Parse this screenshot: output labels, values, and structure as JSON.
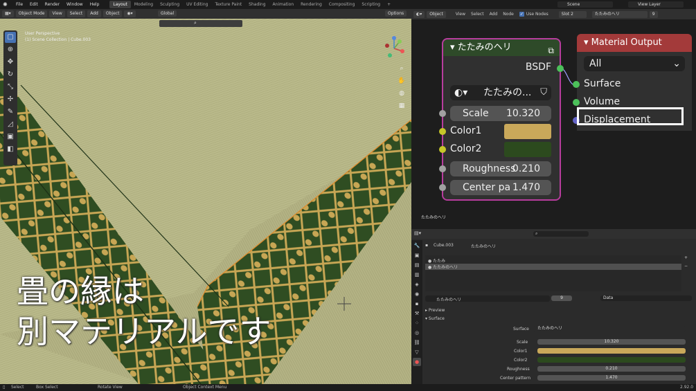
{
  "topbar": {
    "menus": [
      "File",
      "Edit",
      "Render",
      "Window",
      "Help"
    ],
    "workspaces": [
      "Layout",
      "Modeling",
      "Sculpting",
      "UV Editing",
      "Texture Paint",
      "Shading",
      "Animation",
      "Rendering",
      "Compositing",
      "Scripting"
    ],
    "active_workspace": "Layout",
    "scene": "Scene",
    "view_layer": "View Layer"
  },
  "viewport": {
    "mode": "Object Mode",
    "menus": [
      "View",
      "Select",
      "Add",
      "Object"
    ],
    "transform_orientation": "Global",
    "options_label": "Options",
    "info_line1": "User Perspective",
    "info_line2": "(1) Scene Collection | Cube.003",
    "overlay_line1": "畳の縁は",
    "overlay_line2": "別マテリアルです"
  },
  "node_editor": {
    "object_mode": "Object",
    "menus": [
      "View",
      "Select",
      "Add",
      "Node"
    ],
    "use_nodes_label": "Use Nodes",
    "slot": "Slot 2",
    "material_name": "たたみのヘリ",
    "users": "9",
    "footer_label": "たたみのヘリ",
    "group_node": {
      "title": "たたみのヘリ",
      "output": "BSDF",
      "datablock": "たたみの...",
      "inputs": [
        {
          "label": "Scale",
          "value": "10.320"
        },
        {
          "label": "Color1",
          "color": "#c9a85a"
        },
        {
          "label": "Color2",
          "color": "#2c4a1e"
        },
        {
          "label": "Roughness",
          "value": "0.210"
        },
        {
          "label": "Center pa",
          "value": "1.470"
        }
      ]
    },
    "output_node": {
      "title": "Material Output",
      "target": "All",
      "inputs": [
        "Surface",
        "Volume",
        "Displacement"
      ]
    }
  },
  "properties": {
    "object_name": "Cube.003",
    "material_name": "たたみのヘリ",
    "slots": [
      "たたみ",
      "たたみのヘリ"
    ],
    "users": "9",
    "link": "Data",
    "sections": [
      "Preview",
      "Surface"
    ],
    "surface_label": "Surface",
    "surface_value": "たたみのヘリ",
    "rows": [
      {
        "label": "Scale",
        "value": "10.320"
      },
      {
        "label": "Color1",
        "color": "#c9a85a"
      },
      {
        "label": "Color2",
        "color": "#2c4a1e"
      },
      {
        "label": "Roughness",
        "value": "0.210"
      },
      {
        "label": "Center pattern",
        "value": "1.470"
      }
    ]
  },
  "statusbar": {
    "items": [
      "Select",
      "Box Select",
      "Rotate View",
      "Object Context Menu"
    ],
    "version": "2.92.0"
  }
}
